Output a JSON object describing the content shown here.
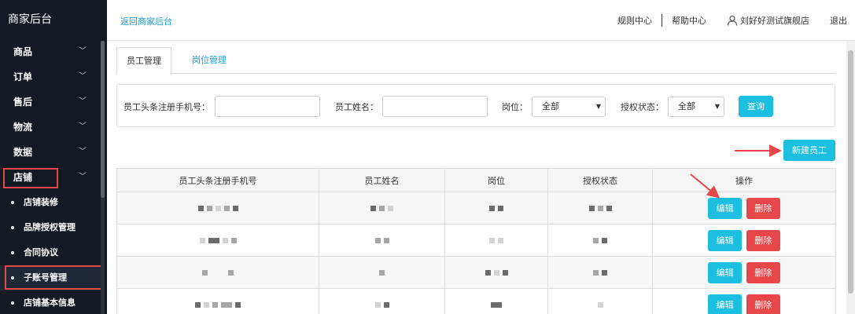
{
  "sidebar": {
    "brand": "商家后台",
    "menu": [
      {
        "label": "商品"
      },
      {
        "label": "订单"
      },
      {
        "label": "售后"
      },
      {
        "label": "物流"
      },
      {
        "label": "数据"
      },
      {
        "label": "店铺"
      }
    ],
    "submenu": [
      {
        "label": "店铺装修"
      },
      {
        "label": "品牌授权管理"
      },
      {
        "label": "合同协议"
      },
      {
        "label": "子账号管理"
      },
      {
        "label": "店铺基本信息"
      }
    ],
    "active_submenu": "子账号管理",
    "highlight_color": "#e8474a"
  },
  "header": {
    "back_link": "返回商家后台",
    "rules": "规则中心",
    "help": "帮助中心",
    "user": "刘好好测试旗舰店",
    "logout": "退出"
  },
  "tabs": [
    {
      "label": "员工管理",
      "active": true
    },
    {
      "label": "岗位管理",
      "active": false
    }
  ],
  "filter": {
    "phone_label": "员工头条注册手机号：",
    "phone_value": "",
    "name_label": "员工姓名：",
    "name_value": "",
    "post_label": "岗位：",
    "post_value": "全部",
    "auth_label": "授权状态：",
    "auth_value": "全部",
    "query_button": "查询"
  },
  "new_button": "新建员工",
  "table": {
    "columns": [
      "员工头条注册手机号",
      "员工姓名",
      "岗位",
      "授权状态",
      "操作"
    ],
    "rows": [
      {
        "edit": "编辑",
        "delete": "删除"
      },
      {
        "edit": "编辑",
        "delete": "删除"
      },
      {
        "edit": "编辑",
        "delete": "删除"
      },
      {
        "edit": "编辑",
        "delete": "删除"
      }
    ]
  },
  "colors": {
    "sidebar_bg": "#131a24",
    "accent": "#1dbfe0",
    "link": "#1a9bd7",
    "danger": "#e8474a"
  }
}
